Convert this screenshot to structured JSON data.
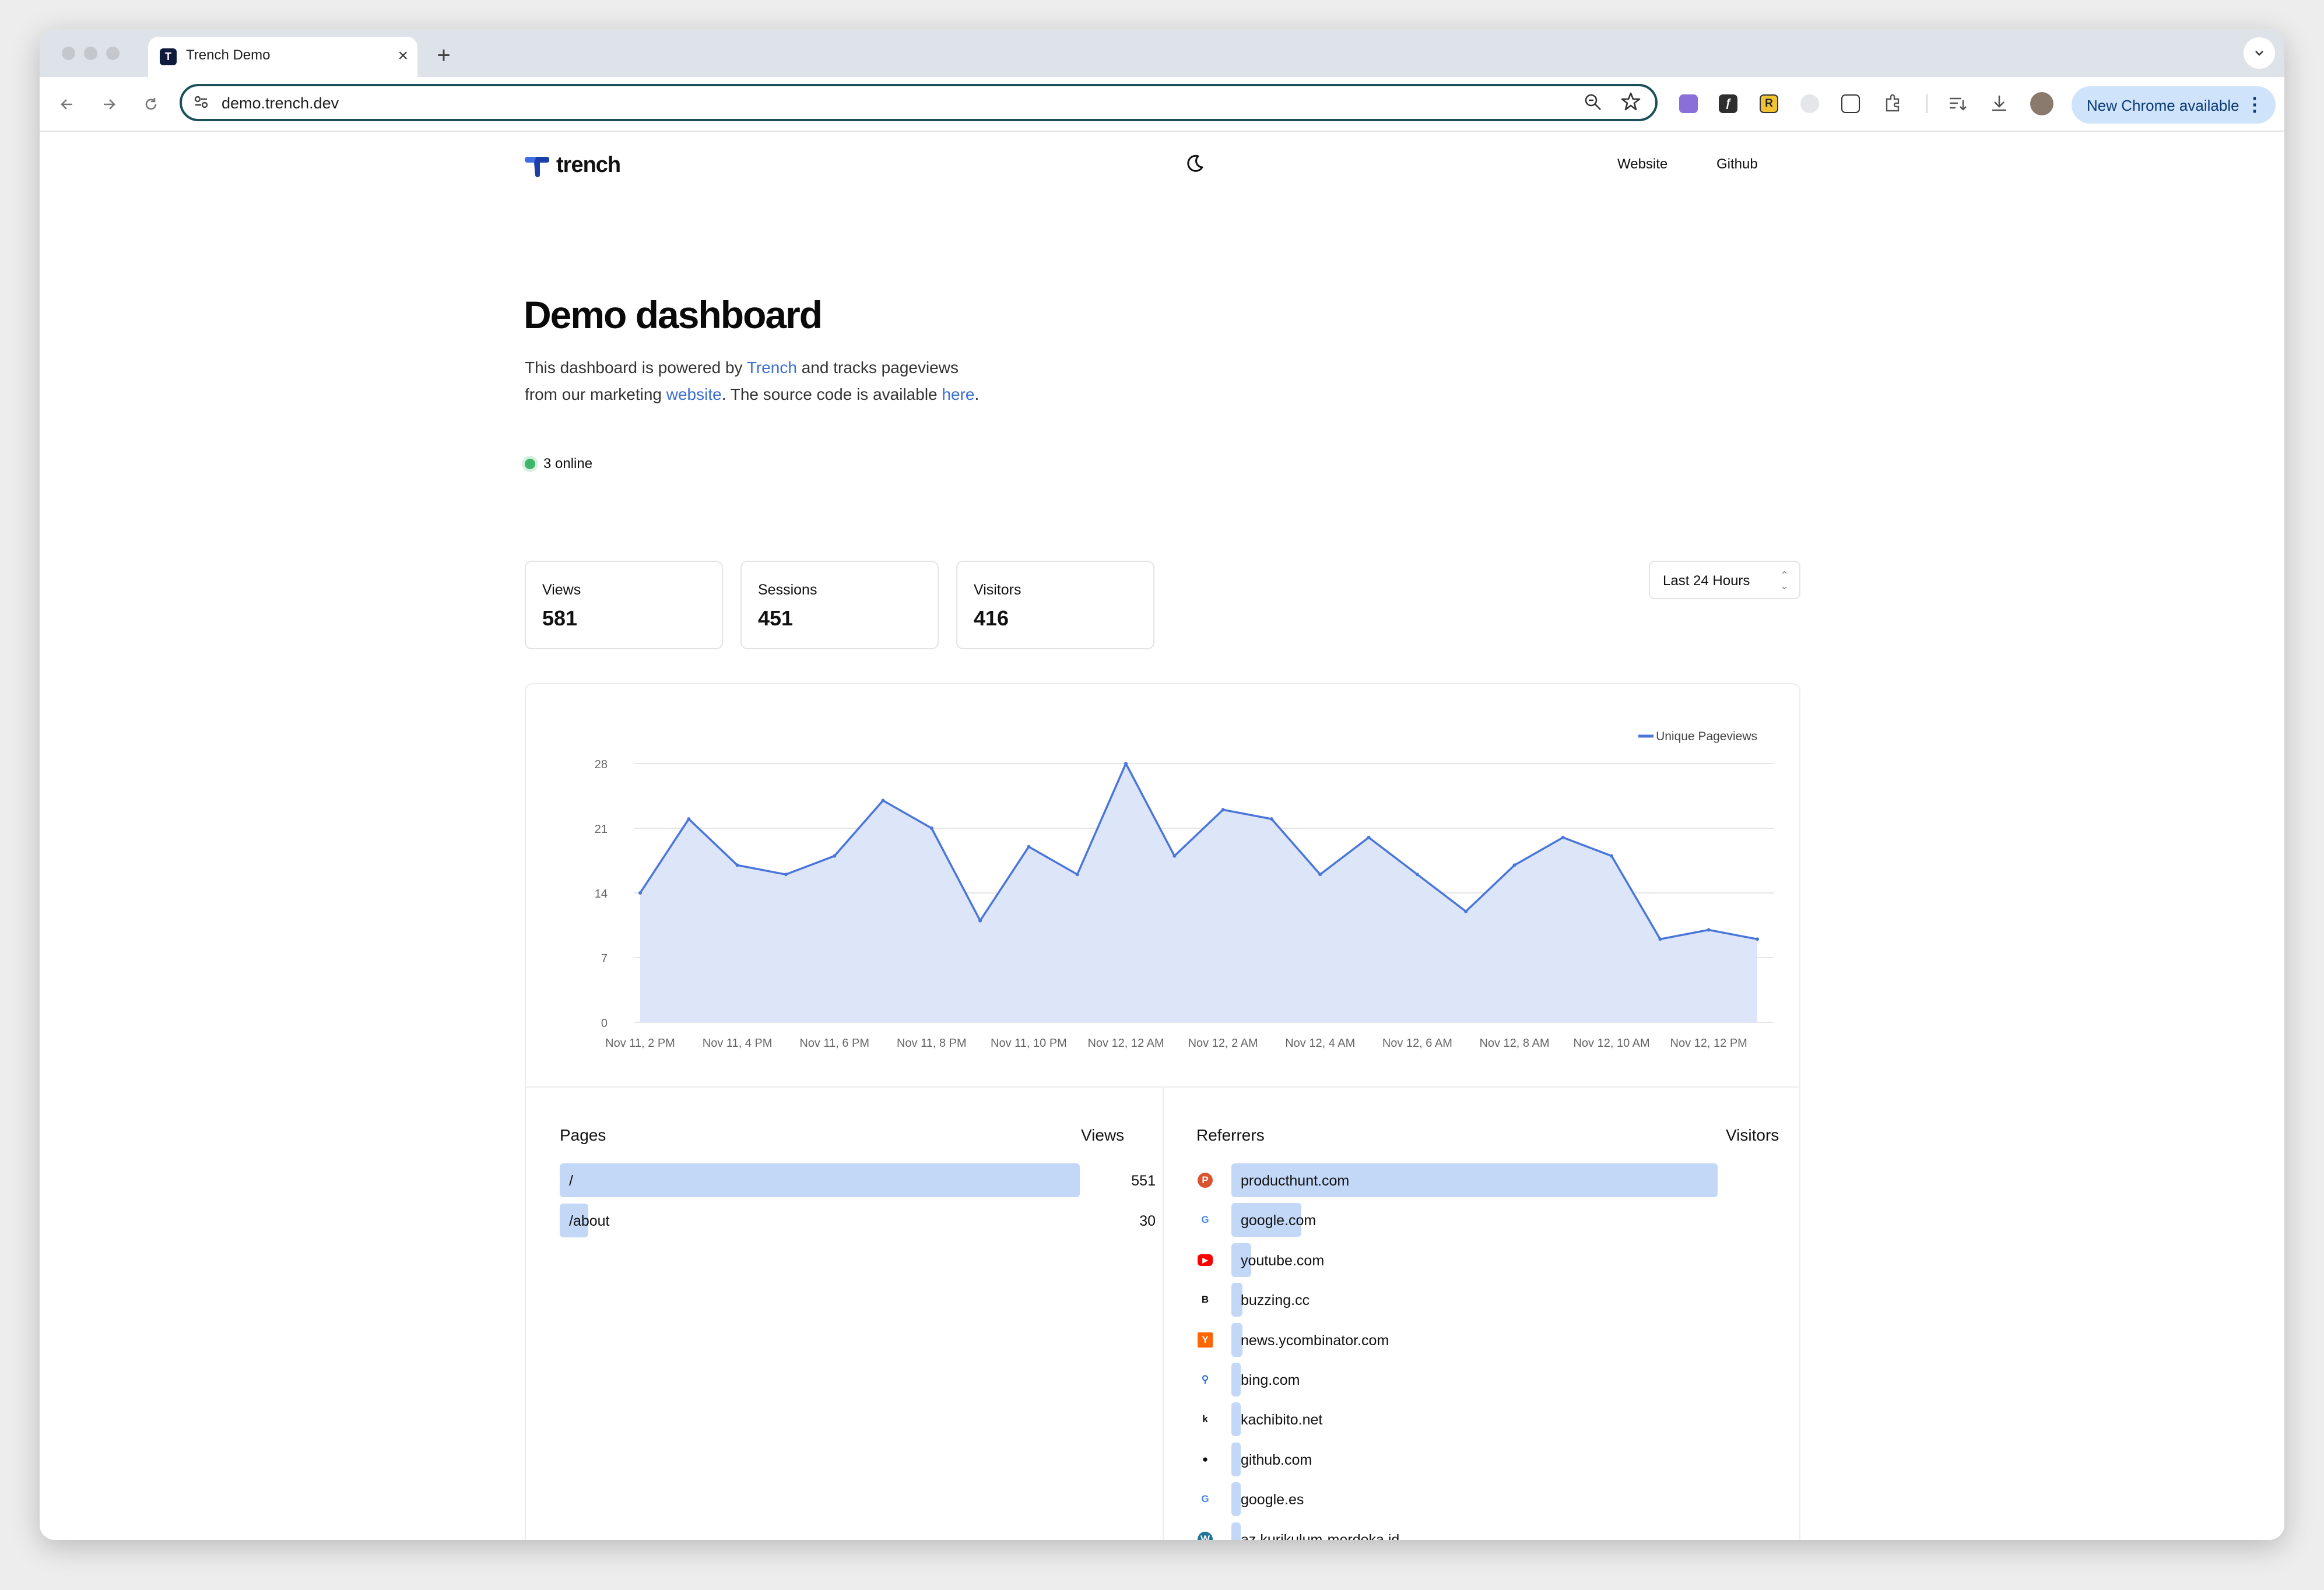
{
  "browser": {
    "tab_title": "Trench Demo",
    "tab_close": "×",
    "new_tab": "+",
    "url": "demo.trench.dev",
    "update_label": "New Chrome available",
    "extension_labels": [
      "ƒ",
      "R"
    ]
  },
  "header": {
    "brand": "trench",
    "links": [
      "Website",
      "Github"
    ]
  },
  "hero": {
    "title": "Demo dashboard",
    "desc_1": "This dashboard is powered by ",
    "desc_link_1": "Trench",
    "desc_2": " and tracks pageviews",
    "desc_3": "from our marketing ",
    "desc_link_2": "website",
    "desc_4": ". The source code is available ",
    "desc_link_3": "here",
    "desc_5": ".",
    "online": "3 online"
  },
  "stats": [
    {
      "label": "Views",
      "value": "581"
    },
    {
      "label": "Sessions",
      "value": "451"
    },
    {
      "label": "Visitors",
      "value": "416"
    }
  ],
  "range_select": "Last 24 Hours",
  "colors": {
    "line": "#4a76d9",
    "area": "#dbe5f8",
    "bar": "#c3d7f7",
    "link": "#3b6fd1",
    "online": "#3fb56c"
  },
  "chart_data": {
    "type": "area",
    "legend": "Unique Pageviews",
    "legend_position": "top-right",
    "x": [
      "Nov 11, 2 PM",
      "Nov 11, 3 PM",
      "Nov 11, 4 PM",
      "Nov 11, 5 PM",
      "Nov 11, 6 PM",
      "Nov 11, 7 PM",
      "Nov 11, 8 PM",
      "Nov 11, 9 PM",
      "Nov 11, 10 PM",
      "Nov 11, 11 PM",
      "Nov 12, 12 AM",
      "Nov 12, 1 AM",
      "Nov 12, 2 AM",
      "Nov 12, 3 AM",
      "Nov 12, 4 AM",
      "Nov 12, 5 AM",
      "Nov 12, 6 AM",
      "Nov 12, 7 AM",
      "Nov 12, 8 AM",
      "Nov 12, 9 AM",
      "Nov 12, 10 AM",
      "Nov 12, 11 AM",
      "Nov 12, 12 PM",
      "Nov 12, 1 PM"
    ],
    "series": [
      {
        "name": "Unique Pageviews",
        "values": [
          14,
          22,
          17,
          16,
          18,
          24,
          21,
          11,
          19,
          16,
          28,
          18,
          23,
          22,
          16,
          20,
          16,
          12,
          17,
          20,
          18,
          9,
          10,
          9
        ]
      }
    ],
    "x_ticks": [
      "Nov 11, 2 PM",
      "Nov 11, 4 PM",
      "Nov 11, 6 PM",
      "Nov 11, 8 PM",
      "Nov 11, 10 PM",
      "Nov 12, 12 AM",
      "Nov 12, 2 AM",
      "Nov 12, 4 AM",
      "Nov 12, 6 AM",
      "Nov 12, 8 AM",
      "Nov 12, 10 AM",
      "Nov 12, 12 PM"
    ],
    "y_ticks": [
      0,
      7,
      14,
      21,
      28
    ],
    "ylim": [
      0,
      28
    ],
    "grid": true
  },
  "pages": {
    "title": "Pages",
    "metric": "Views",
    "rows": [
      {
        "label": "/",
        "value": 551
      },
      {
        "label": "/about",
        "value": 30
      }
    ]
  },
  "referrers": {
    "title": "Referrers",
    "metric": "Visitors",
    "rows": [
      {
        "label": "producthunt.com",
        "value": 222,
        "icon": "producthunt-icon"
      },
      {
        "label": "google.com",
        "value": 32,
        "icon": "google-icon"
      },
      {
        "label": "youtube.com",
        "value": 9,
        "icon": "youtube-icon"
      },
      {
        "label": "buzzing.cc",
        "value": 5,
        "icon": "buzzing-icon"
      },
      {
        "label": "news.ycombinator.com",
        "value": 5,
        "icon": "ycombinator-icon"
      },
      {
        "label": "bing.com",
        "value": 2,
        "icon": "bing-icon"
      },
      {
        "label": "kachibito.net",
        "value": 2,
        "icon": "kachibito-icon"
      },
      {
        "label": "github.com",
        "value": 2,
        "icon": "github-icon"
      },
      {
        "label": "google.es",
        "value": 1,
        "icon": "google-icon"
      },
      {
        "label": "az.kurikulum-merdeka.id",
        "value": 1,
        "icon": "wordpress-icon"
      }
    ]
  }
}
